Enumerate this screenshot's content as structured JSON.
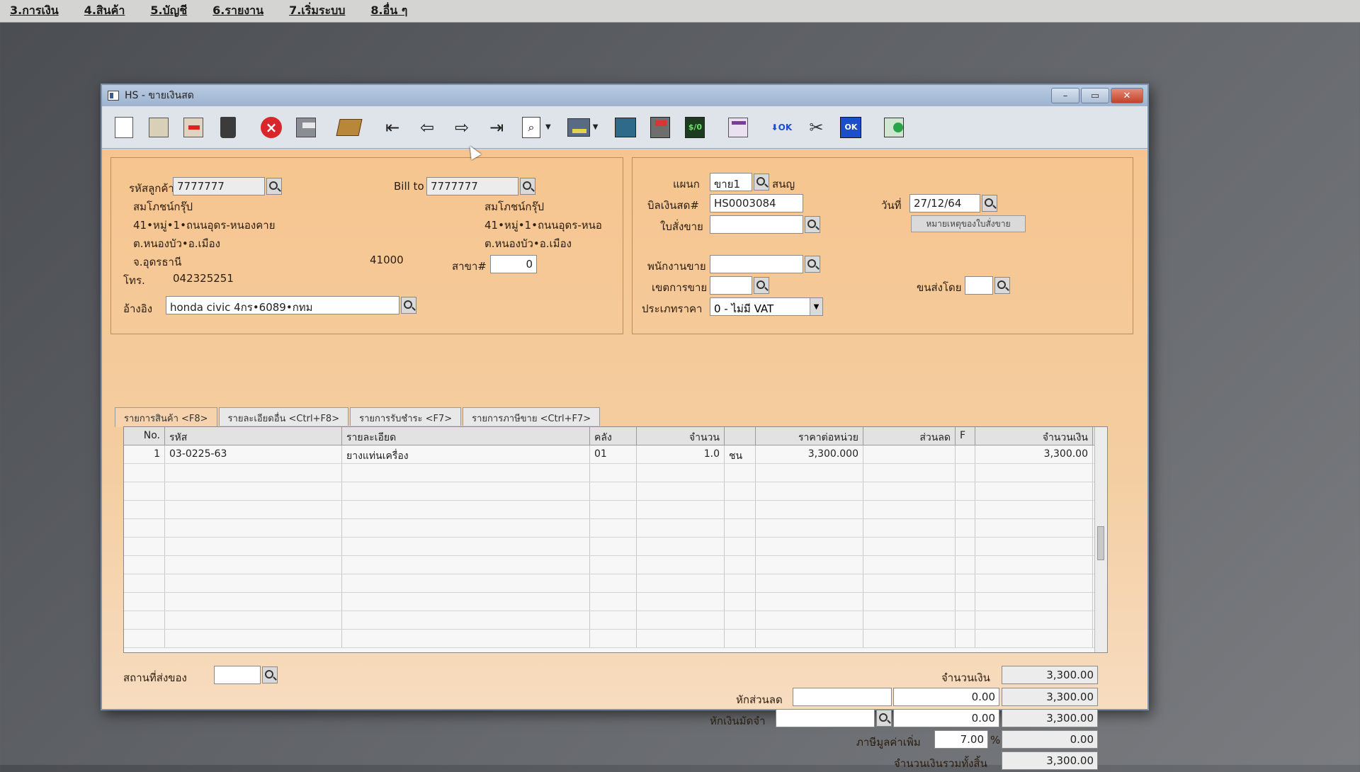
{
  "menu": [
    "3.การเงิน",
    "4.สินค้า",
    "5.บัญชี",
    "6.รายงาน",
    "7.เริ่มระบบ",
    "8.อื่น ๆ"
  ],
  "window": {
    "title": "HS - ขายเงินสด",
    "min": "–",
    "max": "▭",
    "close": "✕"
  },
  "toolbar_icons": [
    "new-document-icon",
    "edit-icon",
    "void-icon",
    "trash-icon",
    "cancel-icon",
    "save-icon",
    "book-icon",
    "first-record-icon",
    "previous-record-icon",
    "next-record-icon",
    "last-record-icon",
    "find-icon",
    "printer-icon",
    "screen-icon",
    "calculator-icon",
    "green-display-icon",
    "calendar-icon",
    "ok-down-icon",
    "scissors-icon",
    "ok-box-icon",
    "grid-icon"
  ],
  "customer": {
    "code_label": "รหัสลูกค้า",
    "code_value": "7777777",
    "name": "สมโภชน์กรุ๊ป",
    "address1": "41•หมู่•1•ถนนอุดร-หนองคาย",
    "address2": "ต.หนองบัว•อ.เมือง",
    "province": "จ.อุดรธานี",
    "zip": "41000",
    "phone_label": "โทร.",
    "phone": "042325251",
    "ref_label": "อ้างอิง",
    "ref_value": "honda civic 4กร•6089•กทม"
  },
  "billto": {
    "label": "Bill to",
    "value": "7777777",
    "name": "สมโภชน์กรุ๊ป",
    "address1": "41•หมู่•1•ถนนอุดร-หนอ",
    "address2": "ต.หนองบัว•อ.เมือง",
    "branch_label": "สาขา#",
    "branch_value": "0"
  },
  "doc": {
    "dept_label": "แผนก",
    "dept_value": "ขาย1",
    "dept_name": "สนญ",
    "bill_label": "บิลเงินสด#",
    "bill_value": "HS0003084",
    "date_label": "วันที่",
    "date_value": "27/12/64",
    "so_label": "ใบสั่งขาย",
    "so_value": "",
    "note_button": "หมายเหตุของใบสั่งขาย",
    "salesman_label": "พนักงานขาย",
    "salesman_value": "",
    "area_label": "เขตการขาย",
    "area_value": "",
    "ship_label": "ขนส่งโดย",
    "ship_value": "",
    "price_type_label": "ประเภทราคา",
    "price_type_value": "0 - ไม่มี VAT"
  },
  "tabs": [
    "รายการสินค้า <F8>",
    "รายละเอียดอื่น <Ctrl+F8>",
    "รายการรับชำระ <F7>",
    "รายการภาษีขาย <Ctrl+F7>"
  ],
  "table": {
    "headers": [
      "No.",
      "รหัส",
      "รายละเอียด",
      "คลัง",
      "จำนวน",
      "",
      "ราคาต่อหน่วย",
      "ส่วนลด",
      "F",
      "จำนวนเงิน"
    ],
    "rows": [
      [
        "1",
        "03-0225-63",
        "ยางแท่นเครื่อง",
        "01",
        "1.0",
        "ชน",
        "3,300.000",
        "",
        "",
        "3,300.00"
      ]
    ],
    "empty_rows": 10
  },
  "footer": {
    "delivery_label": "สถานที่ส่งของ",
    "delivery_value": "",
    "amount_label": "จำนวนเงิน",
    "amount_value": "3,300.00",
    "discount_label": "หักส่วนลด",
    "discount_input": "",
    "discount_value": "0.00",
    "discount_total": "3,300.00",
    "deposit_label": "หักเงินมัดจำ",
    "deposit_input": "",
    "deposit_value": "0.00",
    "deposit_total": "3,300.00",
    "vat_label": "ภาษีมูลค่าเพิ่ม",
    "vat_rate": "7.00",
    "vat_pct": "%",
    "vat_value": "0.00",
    "grand_label": "จำนวนเงินรวมทั้งสิ้น",
    "grand_value": "3,300.00"
  }
}
